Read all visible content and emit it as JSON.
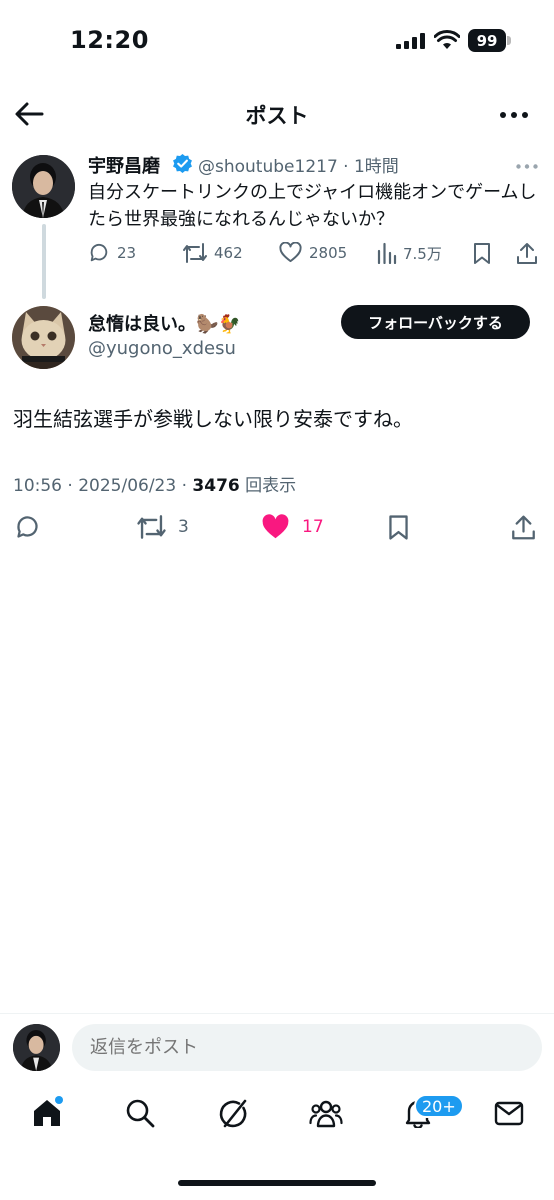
{
  "status_bar": {
    "time": "12:20",
    "battery": "99"
  },
  "header": {
    "title": "ポスト"
  },
  "parent_post": {
    "name": "宇野昌磨",
    "handle_time": "@shoutube1217 · 1時間",
    "text": "自分スケートリンクの上でジャイロ機能オンでゲームしたら世界最強になれるんじゃないか？",
    "replies": "23",
    "reposts": "462",
    "likes": "2805",
    "views": "7.5万"
  },
  "reply_post": {
    "name": "怠惰は良い。🦫🐓",
    "handle": "@yugono_xdesu",
    "follow_label": "フォローバックする",
    "text": "羽生結弦選手が参戦しない限り安泰ですね。",
    "time_date": "10:56 · 2025/06/23 · ",
    "views_count": "3476",
    "views_label": " 回表示",
    "reposts": "3",
    "likes": "17"
  },
  "reply_bar": {
    "placeholder": "返信をポスト"
  },
  "bottom_nav": {
    "notifications_badge": "20+"
  },
  "colors": {
    "accent": "#1d9bf0",
    "like": "#f91880",
    "text": "#0f1419",
    "secondary": "#536471"
  }
}
